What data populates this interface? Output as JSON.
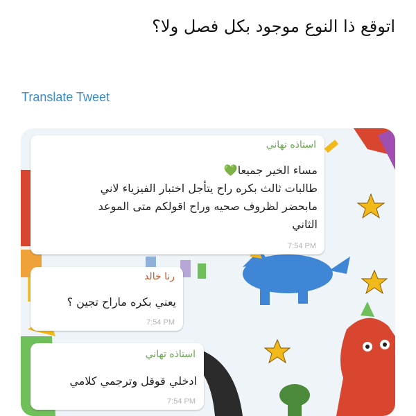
{
  "tweet": {
    "text": "اتوقع ذا النوع موجود بكل فصل ولا؟",
    "translate_label": "Translate Tweet"
  },
  "chat": {
    "messages": [
      {
        "sender": "استاذه تهاني",
        "sender_color": "#6aa84f",
        "lines": [
          "مساء الخير جميعا💚",
          "طالبات ثالث بكره راح يتأجل اختبار الفيزياء لاني",
          "مابحضر لظروف صحيه وراح اقولكم متى الموعد",
          "الثاني"
        ],
        "time": "7:54 PM"
      },
      {
        "sender": "رنا خالد",
        "sender_color": "#c9572a",
        "lines": [
          "يعني بكره ماراح تجين ؟"
        ],
        "time": "7:54 PM"
      },
      {
        "sender": "استاذه تهاني",
        "sender_color": "#6aa84f",
        "lines": [
          "ادخلي قوقل وترجمي كلامي"
        ],
        "time": "7:54 PM"
      }
    ]
  },
  "colors": {
    "link": "#3a8cc8",
    "star": "#f2b91a",
    "dino_blue": "#3f86d6",
    "horse_red": "#d9462f"
  }
}
